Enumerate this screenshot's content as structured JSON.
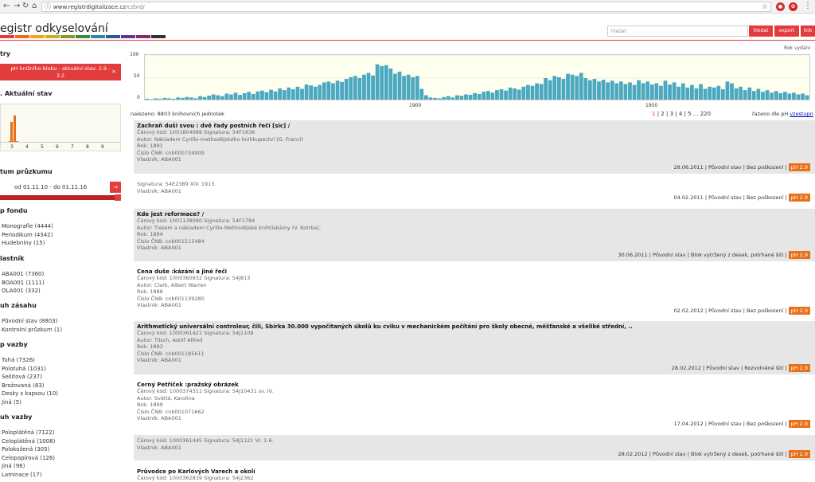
{
  "browser": {
    "url_host": "www.registrdigitalizace.cz",
    "url_path": "/czbrd/"
  },
  "header": {
    "title": "egistr odkyselování",
    "search_placeholder": "hledat",
    "btn_search": "hledat",
    "btn_export": "export",
    "btn_link": "link",
    "stripe_colors": [
      "#e23c3c",
      "#e8701a",
      "#f2a51a",
      "#c9b21a",
      "#8a9a2a",
      "#3c8a3c",
      "#2a8aa0",
      "#2a5a9a",
      "#5a3a8a",
      "#8a2a6a",
      "#333333"
    ]
  },
  "sidebar": {
    "filters_heading": "try",
    "active_filter_line1": "pH knižního bloku - aktuální stav: 2.9 -",
    "active_filter_line2": "3.2",
    "active_filter_close": "×",
    "ph_heading": ". Aktuální stav",
    "ph_ticks": [
      "3",
      "4",
      "5",
      "6",
      "7",
      "8",
      "9"
    ],
    "date_heading": "tum průzkumu",
    "date_range": "od 01.11.10 - do 01.11.16",
    "date_go": "→",
    "fund_heading": "p fondu",
    "fund_items": [
      "Monografie (4444)",
      "Periodikum (4342)",
      "Hudebniny (15)"
    ],
    "owner_heading": "lastník",
    "owner_items": [
      "ABA001 (7360)",
      "BOA001 (1111)",
      "OLA001 (332)"
    ],
    "action_heading": "uh zásahu",
    "action_items": [
      "Původní stav (8803)",
      "Kontrolní průzkum (1)"
    ],
    "binding_heading": "p vazby",
    "binding_items": [
      "Tuhá (7326)",
      "Polotuhá (1031)",
      "Sešitová (237)",
      "Brožovaná (83)",
      "Desky s kapsou (10)",
      "Jiná (5)"
    ],
    "binding2_heading": "uh vazby",
    "binding2_items": [
      "Poloplátěná (7122)",
      "Celoplátěná (1008)",
      "Polokožená (305)",
      "Celopapírová (126)",
      "Jiná (96)",
      "Laminace (17)"
    ]
  },
  "chart_data": {
    "type": "bar",
    "title": "Rok vydání",
    "xlabel": "",
    "ylabel": "",
    "ylim": [
      0,
      100
    ],
    "yticks": [
      "100",
      "50",
      "0"
    ],
    "xticks": [
      "1900",
      "1950"
    ],
    "x_range": [
      1815,
      2015
    ],
    "values": [
      2,
      1,
      3,
      2,
      4,
      3,
      2,
      5,
      4,
      6,
      5,
      3,
      8,
      6,
      9,
      12,
      10,
      8,
      14,
      12,
      16,
      11,
      15,
      18,
      13,
      19,
      21,
      17,
      23,
      19,
      26,
      22,
      28,
      24,
      30,
      25,
      35,
      33,
      30,
      34,
      40,
      42,
      38,
      44,
      41,
      48,
      52,
      55,
      50,
      58,
      62,
      56,
      82,
      78,
      80,
      72,
      60,
      65,
      55,
      58,
      52,
      55,
      25,
      10,
      5,
      4,
      3,
      6,
      8,
      5,
      10,
      9,
      12,
      11,
      15,
      13,
      18,
      20,
      16,
      22,
      24,
      21,
      28,
      26,
      23,
      30,
      34,
      32,
      38,
      36,
      50,
      45,
      55,
      52,
      48,
      60,
      58,
      55,
      62,
      50,
      45,
      48,
      42,
      46,
      40,
      44,
      38,
      42,
      36,
      40,
      34,
      45,
      38,
      42,
      35,
      38,
      32,
      44,
      35,
      40,
      30,
      38,
      28,
      34,
      26,
      36,
      25,
      30,
      28,
      32,
      24,
      42,
      38,
      26,
      30,
      22,
      28,
      20,
      25,
      18,
      22,
      16,
      20,
      15,
      18,
      14,
      16,
      12,
      14,
      10
    ]
  },
  "results": {
    "found": "nalezeno: 8803 knihovních jednotek",
    "pages": [
      "1",
      "|",
      "2",
      "|",
      "3",
      "|",
      "4",
      "|",
      "5",
      "...",
      "220"
    ],
    "sort_label": "řazeno dle pH",
    "sort_link": "vzestupn"
  },
  "records": [
    {
      "title": "Zachraň duši svou : dvě řady postních řečí [sic] /",
      "lines": [
        "Čárový kód: 1001804089 Signatura: 54F1636",
        "Autor: Nákladem Cyrillo-methodějského knihkupectví (G. Francl)",
        "Rok: 1891",
        "Číslo ČNB: cnb000734009",
        "Vlastník: ABA001"
      ],
      "footer": "28.06.2011 | Původní stav | Bez poškození |",
      "ph": "pH 2.9"
    },
    {
      "title": "",
      "lines": [
        "Signatura: 54E2389 XIV. 1913.",
        "Vlastník: ABA001"
      ],
      "footer": "04.02.2011 | Původní stav | Bez poškození |",
      "ph": "pH 2.9"
    },
    {
      "title": "Kde jest reformace? /",
      "lines": [
        "Čárový kód: 1001138080 Signatura: 54F1784",
        "Autor: Tiskem a nákladem Cyrillo-Methodějské knihtiskárny (V. Kotrba),",
        "Rok: 1894",
        "Číslo ČNB: cnb001515484",
        "Vlastník: ABA001"
      ],
      "footer": "30.06.2011 | Původní stav | Blok vytržený z desek, potrhané šití |",
      "ph": "pH 2.9"
    },
    {
      "title": "Cena duše :kázání a jiné řeči",
      "lines": [
        "Čárový kód: 1000360932 Signatura: 54J813",
        "Autor: Clark, Albert Warren",
        "Rok: 1888",
        "Číslo ČNB: cnb001139280",
        "Vlastník: ABA001"
      ],
      "footer": "02.02.2012 | Původní stav | Bez poškození |",
      "ph": "pH 2.9"
    },
    {
      "title": "Arithmetický universální controleur, čili, Sbírka 30.000 vypočítaných úkolů ku cviku v mechanickém počítání pro školy obecné, měšťanské a všeliké střední, ..",
      "lines": [
        "Čárový kód: 1000361421 Signatura: 54J1108",
        "Autor: Tilsch, Adolf Alfred",
        "Rok: 1893",
        "Číslo ČNB: cnb001185611",
        "Vlastník: ABA001"
      ],
      "footer": "28.02.2012 | Původní stav | Rozvolněné šití |",
      "ph": "pH 2.9"
    },
    {
      "title": "Černý Petříček :pražský obrázek",
      "lines": [
        "Čárový kód: 1000374311 Signatura: 54J10431 sv. IV.",
        "Autor: Světlá, Karolina",
        "Rok: 1899",
        "Číslo ČNB: cnb001071662",
        "Vlastník: ABA001"
      ],
      "footer": "17.04.2012 | Původní stav | Bez poškození |",
      "ph": "pH 2.9"
    },
    {
      "title": "",
      "lines": [
        "Čárový kód: 1000361445 Signatura: 54J1121 VI. 1-6.",
        "Vlastník: ABA001"
      ],
      "footer": "28.02.2012 | Původní stav | Blok vytržený z desek, potrhané šití |",
      "ph": "pH 2.9"
    },
    {
      "title": "Průvodce po Karlových Varech a okolí",
      "lines": [
        "Čárový kód: 1000362839 Signatura: 54J2362"
      ],
      "footer": "",
      "ph": ""
    }
  ]
}
